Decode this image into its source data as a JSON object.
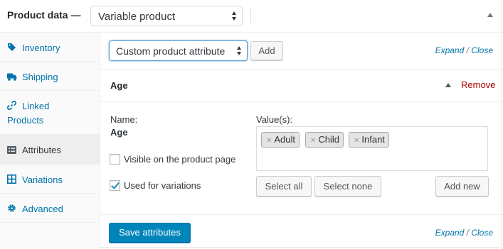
{
  "header": {
    "title": "Product data —",
    "product_type": "Variable product"
  },
  "sidebar": {
    "items": [
      {
        "label": "Inventory",
        "icon": "tag-icon"
      },
      {
        "label": "Shipping",
        "icon": "truck-icon"
      },
      {
        "label": "Linked Products",
        "icon": "link-icon"
      },
      {
        "label": "Attributes",
        "icon": "list-icon",
        "active": true
      },
      {
        "label": "Variations",
        "icon": "grid-icon"
      },
      {
        "label": "Advanced",
        "icon": "gear-icon"
      }
    ]
  },
  "toolbar": {
    "attribute_select": "Custom product attribute",
    "add_label": "Add",
    "expand_label": "Expand",
    "slash": "/",
    "close_label": "Close"
  },
  "attribute": {
    "title": "Age",
    "remove_label": "Remove",
    "name_label": "Name:",
    "name_value": "Age",
    "visible_label": "Visible on the product page",
    "visible_checked": false,
    "variations_label": "Used for variations",
    "variations_checked": true,
    "values_label": "Value(s):",
    "values": [
      "Adult",
      "Child",
      "Infant"
    ],
    "select_all_label": "Select all",
    "select_none_label": "Select none",
    "add_new_label": "Add new"
  },
  "footer": {
    "save_label": "Save attributes",
    "expand_label": "Expand",
    "slash": "/",
    "close_label": "Close"
  },
  "colors": {
    "accent": "#0073aa",
    "primary_button": "#0085ba",
    "remove": "#aa0000"
  }
}
